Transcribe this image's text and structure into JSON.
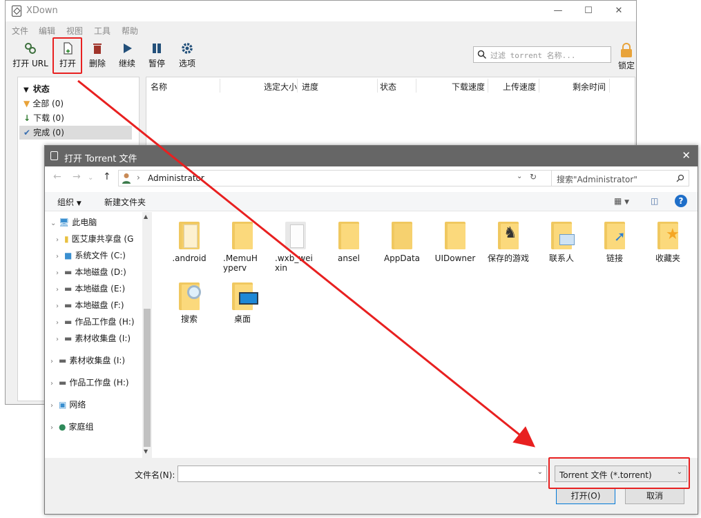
{
  "xdown": {
    "title": "XDown",
    "menu": [
      "文件",
      "编辑",
      "视图",
      "工具",
      "帮助"
    ],
    "toolbar": [
      "打开 URL",
      "打开",
      "删除",
      "继续",
      "暂停",
      "选项"
    ],
    "filter_placeholder": "过滤 torrent 名称...",
    "lock_label": "锁定",
    "sidebar": {
      "header": "状态",
      "items": [
        "全部 (0)",
        "下载 (0)",
        "完成 (0)"
      ]
    },
    "columns": [
      "名称",
      "选定大小",
      "进度",
      "状态",
      "下载速度",
      "上传速度",
      "剩余时间"
    ]
  },
  "dialog": {
    "title": "打开 Torrent 文件",
    "address": "Administrator",
    "search_placeholder": "搜索\"Administrator\"",
    "commands": [
      "组织",
      "新建文件夹"
    ],
    "tree": [
      "此电脑",
      "医艾康共享盘 (G",
      "系统文件 (C:)",
      "本地磁盘 (D:)",
      "本地磁盘 (E:)",
      "本地磁盘 (F:)",
      "作品工作盘 (H:)",
      "素材收集盘 (I:)",
      "素材收集盘 (I:)",
      "作品工作盘 (H:)",
      "网络",
      "家庭组"
    ],
    "files": [
      ".android",
      ".MemuHyperv",
      ".wxb_weixin",
      "ansel",
      "AppData",
      "UIDowner",
      "保存的游戏",
      "联系人",
      "链接",
      "收藏夹",
      "搜索",
      "桌面"
    ],
    "filename_label": "文件名(N):",
    "filename_value": "",
    "filetype": "Torrent 文件 (*.torrent)",
    "open_button": "打开(O)",
    "cancel_button": "取消"
  },
  "colors": {
    "annotation": "#e82020",
    "dialog_titlebar": "#666666"
  }
}
